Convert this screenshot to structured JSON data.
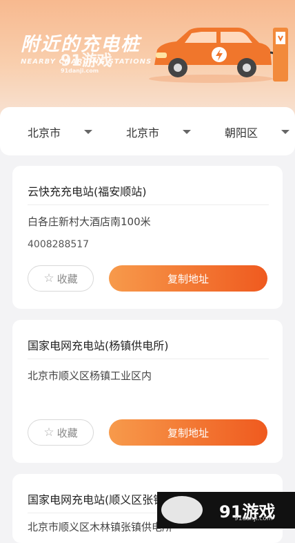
{
  "header": {
    "title": "附近的充电桩",
    "subtitle": "NEARBY CHARGING STATIONS",
    "watermark": "91游戏",
    "watermark_sub": "91danji.com"
  },
  "filters": [
    {
      "label": "北京市"
    },
    {
      "label": "北京市"
    },
    {
      "label": "朝阳区"
    }
  ],
  "stations": [
    {
      "name": "云快充充电站(福安顺站)",
      "address": "白各庄新村大酒店南100米",
      "phone": "4008288517",
      "fav_label": "收藏",
      "copy_label": "复制地址"
    },
    {
      "name": "国家电网充电站(杨镇供电所)",
      "address": "北京市顺义区杨镇工业区内",
      "phone": "",
      "fav_label": "收藏",
      "copy_label": "复制地址"
    },
    {
      "name": "国家电网充电站(顺义区张镇供",
      "address": "北京市顺义区木林镇张镇供电所"
    }
  ],
  "badge": {
    "text": "91游戏",
    "domain": "91danji.com"
  },
  "colors": {
    "accent": "#ef5a1f",
    "header": "#f7b98f"
  }
}
